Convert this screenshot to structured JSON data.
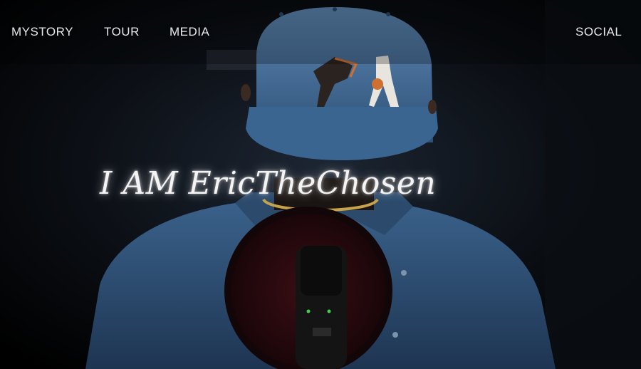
{
  "nav": {
    "items": [
      "MYSTORY",
      "TOUR",
      "MEDIA"
    ],
    "social_label": "SOCIAL"
  },
  "hero": {
    "title": "I AM EricTheChosen"
  },
  "colors": {
    "background": "#000000",
    "nav_text": "#e6e8ec",
    "denim": "#3e6a96",
    "mic_ring": "#5a1a22"
  }
}
